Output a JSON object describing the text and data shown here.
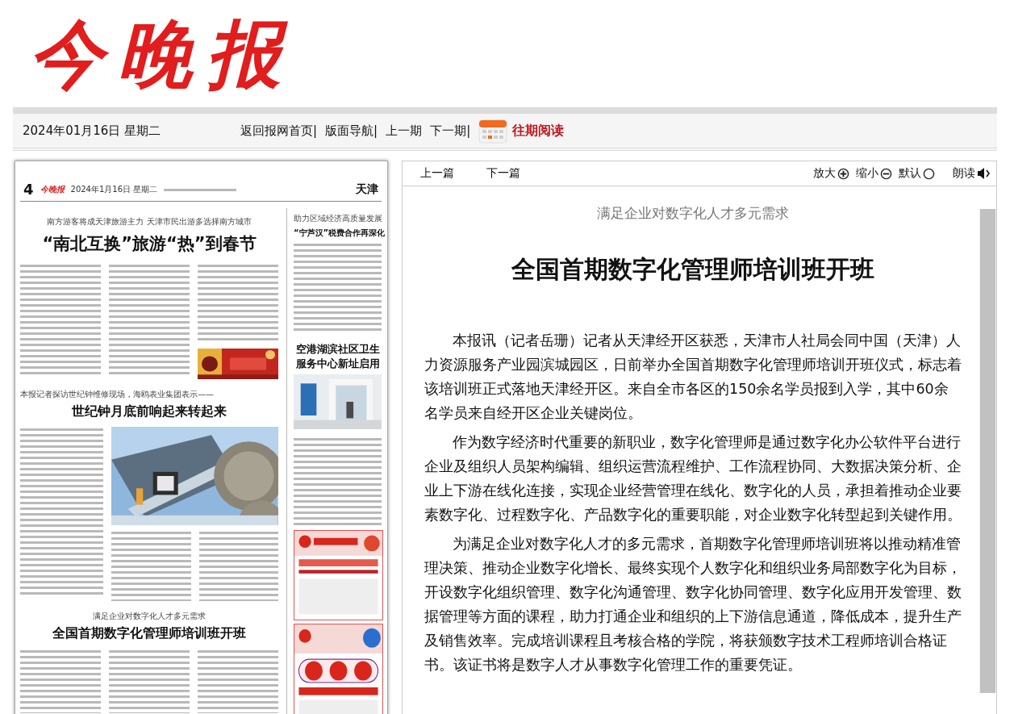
{
  "masthead": {
    "logo": "今晚报"
  },
  "nav": {
    "date": "2024年01月16日 星期二",
    "links": [
      "返回报网首页|",
      "版面导航|",
      "上一期",
      "下一期|"
    ],
    "archive": "往期阅读"
  },
  "page_scan": {
    "page_number": "4",
    "logo": "今晚报",
    "date": "2024年1月16日 星期二",
    "section": "天津",
    "main_stories": [
      {
        "kicker": "南方游客将成天津旅游主力 天津市民出游多选择南方城市",
        "headline": "“南北互换”旅游“热”到春节"
      },
      {
        "kicker": "本报记者探访世纪钟维修现场，海鸥表业集团表示——",
        "headline": "世纪钟月底前响起来转起来"
      },
      {
        "kicker": "满足企业对数字化人才多元需求",
        "headline": "全国首期数字化管理师培训班开班"
      }
    ],
    "side_stories": [
      {
        "kicker": "助力区域经济高质量发展",
        "headline": "“宁芦汉”税费合作再深化"
      },
      {
        "headline": "空港湖滨社区卫生服务中心新址启用"
      }
    ]
  },
  "article_toolbar": {
    "prev": "上一篇",
    "next": "下一篇",
    "controls": [
      {
        "label": "放大",
        "kind": "zoom-in"
      },
      {
        "label": "缩小",
        "kind": "zoom-out"
      },
      {
        "label": "默认",
        "kind": "reset"
      },
      {
        "label": "朗读",
        "kind": "read"
      }
    ]
  },
  "article": {
    "subtitle": "满足企业对数字化人才多元需求",
    "title": "全国首期数字化管理师培训班开班",
    "paragraphs": [
      "本报讯（记者岳珊）记者从天津经开区获悉，天津市人社局会同中国（天津）人力资源服务产业园滨城园区，日前举办全国首期数字化管理师培训开班仪式，标志着该培训班正式落地天津经开区。来自全市各区的150余名学员报到入学，其中60余名学员来自经开区企业关键岗位。",
      "作为数字经济时代重要的新职业，数字化管理师是通过数字化办公软件平台进行企业及组织人员架构编辑、组织运营流程维护、工作流程协同、大数据决策分析、企业上下游在线化连接，实现企业经营管理在线化、数字化的人员，承担着推动企业要素数字化、过程数字化、产品数字化的重要职能，对企业数字化转型起到关键作用。",
      "为满足企业对数字化人才的多元需求，首期数字化管理师培训班将以推动精准管理决策、推动企业数字化增长、最终实现个人数字化和组织业务局部数字化为目标，开设数字化组织管理、数字化沟通管理、数字化协同管理、数字化应用开发管理、数据管理等方面的课程，助力打通企业和组织的上下游信息通道，降低成本，提升生产及销售效率。完成培训课程且考核合格的学院，将获颁数字技术工程师培训合格证书。该证书将是数字人才从事数字化管理工作的重要凭证。"
    ]
  }
}
